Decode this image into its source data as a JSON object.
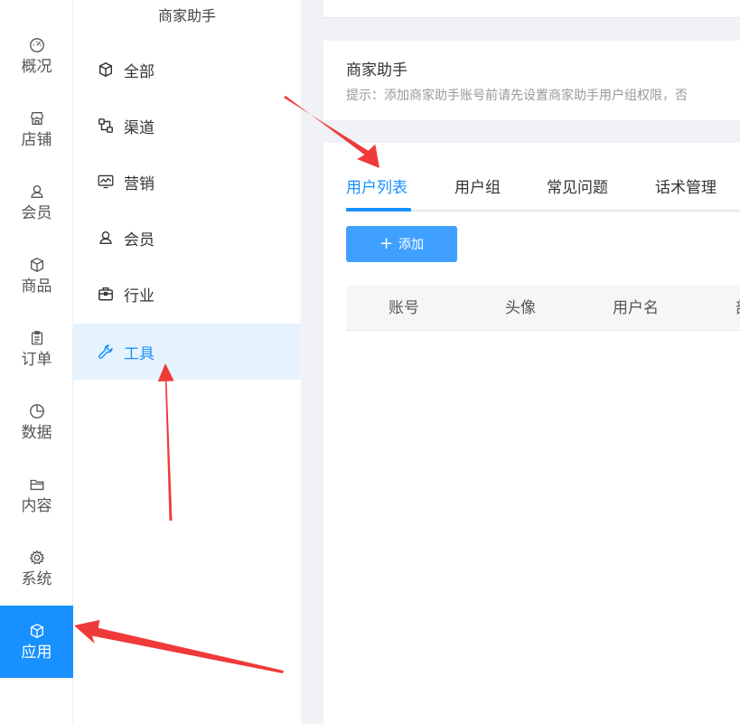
{
  "left_nav": [
    {
      "label": "概况",
      "icon": "dashboard-icon"
    },
    {
      "label": "店铺",
      "icon": "store-icon"
    },
    {
      "label": "会员",
      "icon": "user-icon"
    },
    {
      "label": "商品",
      "icon": "cube-icon"
    },
    {
      "label": "订单",
      "icon": "clipboard-icon"
    },
    {
      "label": "数据",
      "icon": "pie-chart-icon"
    },
    {
      "label": "内容",
      "icon": "folder-icon"
    },
    {
      "label": "系统",
      "icon": "gear-icon"
    },
    {
      "label": "应用",
      "icon": "cube-icon",
      "active": true
    }
  ],
  "sub_nav": {
    "title": "商家助手",
    "items": [
      {
        "label": "全部",
        "icon": "cube-icon"
      },
      {
        "label": "渠道",
        "icon": "channel-icon"
      },
      {
        "label": "营销",
        "icon": "monitor-chart-icon"
      },
      {
        "label": "会员",
        "icon": "user-icon"
      },
      {
        "label": "行业",
        "icon": "briefcase-icon"
      },
      {
        "label": "工具",
        "icon": "wrench-icon",
        "active": true
      }
    ]
  },
  "main": {
    "title": "商家助手",
    "tip": "提示：添加商家助手账号前请先设置商家助手用户组权限，否",
    "tabs": [
      {
        "label": "用户列表",
        "active": true
      },
      {
        "label": "用户组"
      },
      {
        "label": "常见问题"
      },
      {
        "label": "话术管理"
      }
    ],
    "add_button": {
      "plus": "+",
      "label": "添加"
    },
    "table_headers": [
      "账号",
      "头像",
      "用户名",
      "部"
    ]
  },
  "colors": {
    "accent": "#1890ff",
    "active_sub_bg": "#e6f3fe",
    "annotation_arrow": "#f03a3a"
  }
}
